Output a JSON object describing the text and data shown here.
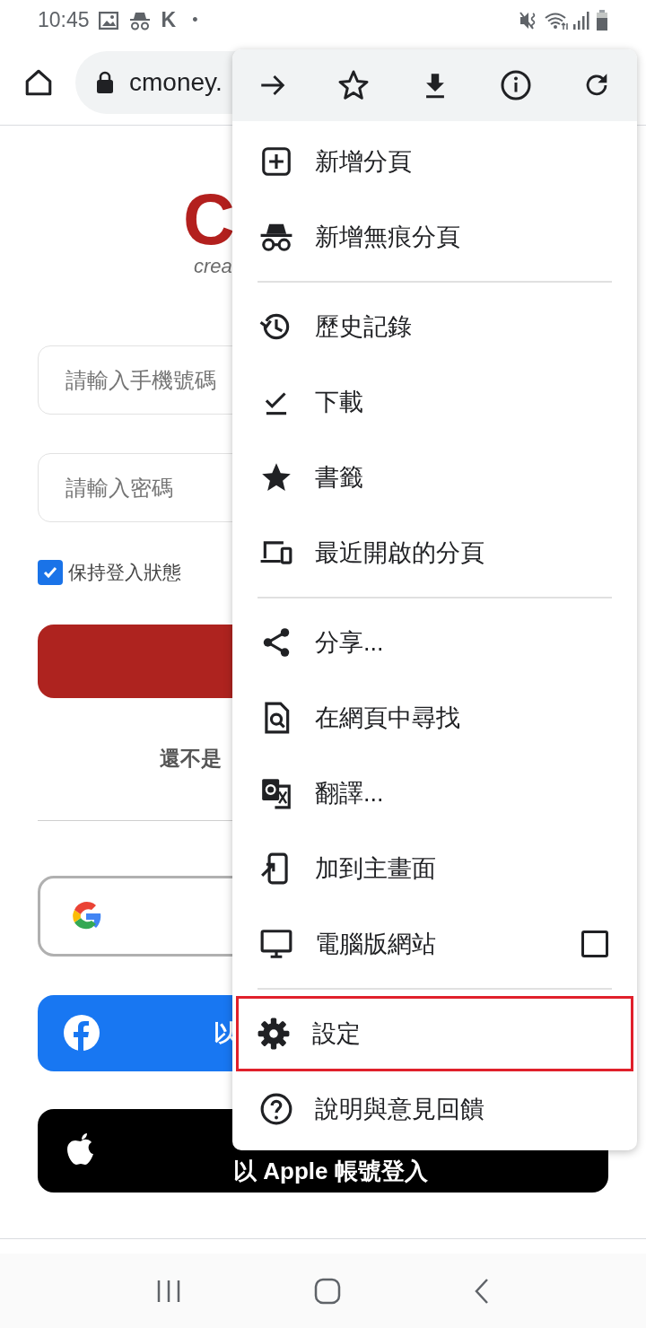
{
  "status_bar": {
    "time": "10:45",
    "notification_letter": "K",
    "more_dot": "•"
  },
  "address_bar": {
    "url": "cmoney."
  },
  "page": {
    "logo_letter": "C",
    "logo_tagline": "crea",
    "phone_placeholder": "請輸入手機號碼",
    "password_placeholder": "請輸入密碼",
    "remember": {
      "label": "保持登入狀態",
      "checked": true
    },
    "signup_prompt": "還不是",
    "facebook_label": "以",
    "apple_label": "以 Apple 帳號登入"
  },
  "menu": {
    "groups": [
      [
        {
          "kind": "item",
          "label": "新增分頁"
        },
        {
          "kind": "item",
          "label": "新增無痕分頁"
        }
      ],
      [
        {
          "kind": "item",
          "label": "歷史記錄"
        },
        {
          "kind": "item",
          "label": "下載"
        },
        {
          "kind": "item",
          "label": "書籤"
        },
        {
          "kind": "item",
          "label": "最近開啟的分頁"
        }
      ],
      [
        {
          "kind": "item",
          "label": "分享..."
        },
        {
          "kind": "item",
          "label": "在網頁中尋找"
        },
        {
          "kind": "item",
          "label": "翻譯..."
        },
        {
          "kind": "item",
          "label": "加到主畫面"
        },
        {
          "kind": "checkbox",
          "label": "電腦版網站",
          "checked": false
        }
      ],
      [
        {
          "kind": "item",
          "label": "設定",
          "highlighted": true
        },
        {
          "kind": "item",
          "label": "說明與意見回饋",
          "highlighted": false
        }
      ]
    ]
  }
}
